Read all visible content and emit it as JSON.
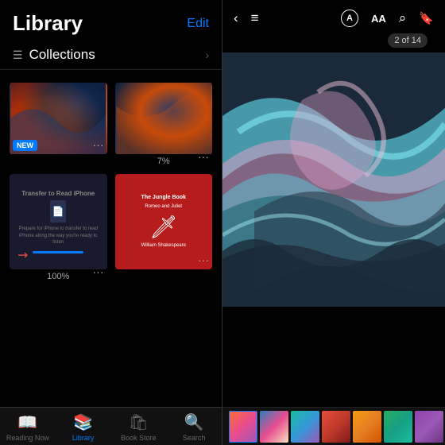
{
  "left": {
    "title": "Library",
    "edit_label": "Edit",
    "collections_label": "Collections",
    "books": [
      {
        "type": "abstract1",
        "badge": "NEW",
        "progress": null
      },
      {
        "type": "abstract2",
        "progress": "7%"
      },
      {
        "type": "transfer",
        "title": "Transfer to Read iPhone",
        "progress_pct": "100%"
      },
      {
        "type": "romeo",
        "title_top": "The Jungle Book",
        "title_mid": "Romeo and Juliet",
        "author": "William Shakespeare"
      }
    ],
    "tab_bar": [
      {
        "id": "reading-now",
        "label": "Reading Now",
        "icon": "📖",
        "active": false
      },
      {
        "id": "library",
        "label": "Library",
        "icon": "📚",
        "active": true
      },
      {
        "id": "book-store",
        "label": "Book Store",
        "icon": "🛍",
        "active": false
      },
      {
        "id": "search",
        "label": "Search",
        "icon": "🔍",
        "active": false
      }
    ]
  },
  "right": {
    "page_indicator": "2 of 14",
    "header_icons": {
      "back": "‹",
      "list": "≡",
      "circle_a": "Ⓐ",
      "aa": "AA",
      "search": "⌕",
      "bookmark": "🔖"
    },
    "thumbnails": [
      1,
      2,
      3,
      4,
      5,
      6,
      7,
      8
    ]
  }
}
